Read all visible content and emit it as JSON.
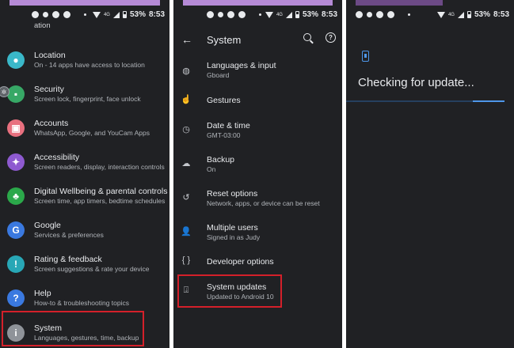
{
  "status": {
    "battery": "53%",
    "time": "8:53",
    "network": "4G"
  },
  "settings": {
    "clipped_label": "ation",
    "items": [
      {
        "title": "Location",
        "sub": "On - 14 apps have access to location",
        "icon": "location-icon",
        "color": "#3ab8c9"
      },
      {
        "title": "Security",
        "sub": "Screen lock, fingerprint, face unlock",
        "icon": "lock-icon",
        "color": "#37a866"
      },
      {
        "title": "Accounts",
        "sub": "WhatsApp, Google, and YouCam Apps",
        "icon": "account-icon",
        "color": "#e8707f"
      },
      {
        "title": "Accessibility",
        "sub": "Screen readers, display, interaction controls",
        "icon": "accessibility-icon",
        "color": "#8e5ad0"
      },
      {
        "title": "Digital Wellbeing & parental controls",
        "sub": "Screen time, app timers, bedtime schedules",
        "icon": "wellbeing-icon",
        "color": "#2ba84a"
      },
      {
        "title": "Google",
        "sub": "Services & preferences",
        "icon": "google-icon",
        "color": "#3a79e0"
      },
      {
        "title": "Rating & feedback",
        "sub": "Screen suggestions & rate your device",
        "icon": "feedback-icon",
        "color": "#28a7b6"
      },
      {
        "title": "Help",
        "sub": "How-to & troubleshooting topics",
        "icon": "help-icon",
        "color": "#3a79e0"
      },
      {
        "title": "System",
        "sub": "Languages, gestures, time, backup",
        "icon": "info-icon",
        "color": "#8f9399"
      }
    ]
  },
  "system": {
    "title": "System",
    "items": [
      {
        "title": "Languages & input",
        "sub": "Gboard",
        "icon": "globe-icon"
      },
      {
        "title": "Gestures",
        "sub": "",
        "icon": "gesture-icon"
      },
      {
        "title": "Date & time",
        "sub": "GMT-03:00",
        "icon": "clock-icon"
      },
      {
        "title": "Backup",
        "sub": "On",
        "icon": "cloud-icon"
      },
      {
        "title": "Reset options",
        "sub": "Network, apps, or device can be reset",
        "icon": "reset-icon"
      },
      {
        "title": "Multiple users",
        "sub": "Signed in as Judy",
        "icon": "users-icon"
      },
      {
        "title": "Developer options",
        "sub": "",
        "icon": "code-icon"
      },
      {
        "title": "System updates",
        "sub": "Updated to Android 10",
        "icon": "system-update-icon"
      }
    ]
  },
  "update": {
    "title": "Checking for update...",
    "progress": 0.2
  }
}
